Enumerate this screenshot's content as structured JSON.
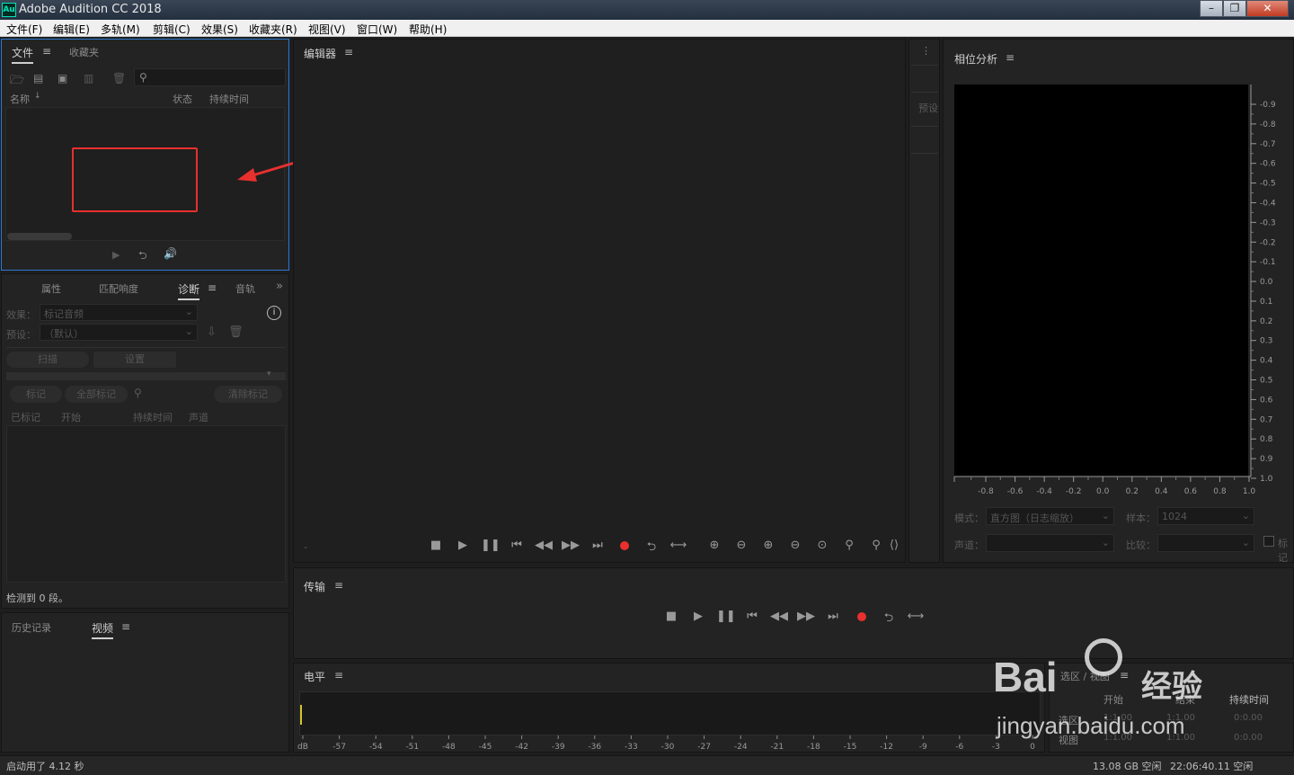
{
  "window": {
    "logo": "Au",
    "title": "Adobe Audition CC 2018",
    "buttons": [
      "minimize-icon",
      "maximize-icon",
      "close-icon"
    ]
  },
  "menu": [
    "文件(F)",
    "编辑(E)",
    "多轨(M)",
    "剪辑(C)",
    "效果(S)",
    "收藏夹(R)",
    "视图(V)",
    "窗口(W)",
    "帮助(H)"
  ],
  "files_panel": {
    "tabs": [
      "文件",
      "收藏夹"
    ],
    "cols": {
      "name": "名称",
      "status": "状态",
      "duration": "持续时间"
    },
    "search_placeholder": ""
  },
  "diag_panel": {
    "tabs": [
      "属性",
      "匹配响度",
      "诊断",
      "音轨"
    ],
    "effect_label": "效果：",
    "effect_value": "标记音频",
    "preset_label": "预设：",
    "preset_value": "（默认）",
    "scan": "扫描",
    "settings": "设置",
    "mark": "标记",
    "mark_all": "全部标记",
    "clear_marks": "清除标记",
    "cols": [
      "已标记",
      "开始",
      "持续时间",
      "声道"
    ],
    "status": "检测到 0 段。"
  },
  "history_panel": {
    "tabs": [
      "历史记录",
      "视频"
    ]
  },
  "editor": {
    "title": "编辑器",
    "side_label": "预设",
    "time": "-"
  },
  "transport": {
    "title": "传输"
  },
  "levels": {
    "title": "电平",
    "ticks": [
      "dB",
      "-57",
      "-54",
      "-51",
      "-48",
      "-45",
      "-42",
      "-39",
      "-36",
      "-33",
      "-30",
      "-27",
      "-24",
      "-21",
      "-18",
      "-15",
      "-12",
      "-9",
      "-6",
      "-3",
      "0"
    ]
  },
  "phase": {
    "title": "相位分析",
    "yticks": [
      "-0.9",
      "-0.8",
      "-0.7",
      "-0.6",
      "-0.5",
      "-0.4",
      "-0.3",
      "-0.2",
      "-0.1",
      "0.0",
      "0.1",
      "0.2",
      "0.3",
      "0.4",
      "0.5",
      "0.6",
      "0.7",
      "0.8",
      "0.9",
      "1.0"
    ],
    "xticks": [
      "-0.8",
      "-0.6",
      "-0.4",
      "-0.2",
      "0.0",
      "0.2",
      "0.4",
      "0.6",
      "0.8",
      "1.0"
    ],
    "mode_label": "模式：",
    "mode_value": "直方图（日志缩放）",
    "samples_label": "样本：",
    "samples_value": "1024",
    "channel_label": "声道：",
    "compare_label": "比较：",
    "checkbox_label": "标记"
  },
  "selection": {
    "title": "选区 / 视图",
    "col_start": "开始",
    "col_end": "结束",
    "col_duration": "持续时间",
    "rows": [
      {
        "label": "选区",
        "start": "1:1.00",
        "end": "1:1.00",
        "duration": "0:0.00"
      },
      {
        "label": "视图",
        "start": "1:1.00",
        "end": "1:1.00",
        "duration": "0:0.00"
      }
    ]
  },
  "statusbar": {
    "left": "启动用了 4.12 秒",
    "disk": "13.08 GB 空闲",
    "time": "22:06:40.11 空闲"
  },
  "watermark": {
    "brand": "Bai",
    "brand2": "经验",
    "url": "jingyan.baidu.com"
  },
  "colors": {
    "accent": "#2d77d2",
    "record": "#e8302f",
    "annotation": "#e8302f"
  }
}
